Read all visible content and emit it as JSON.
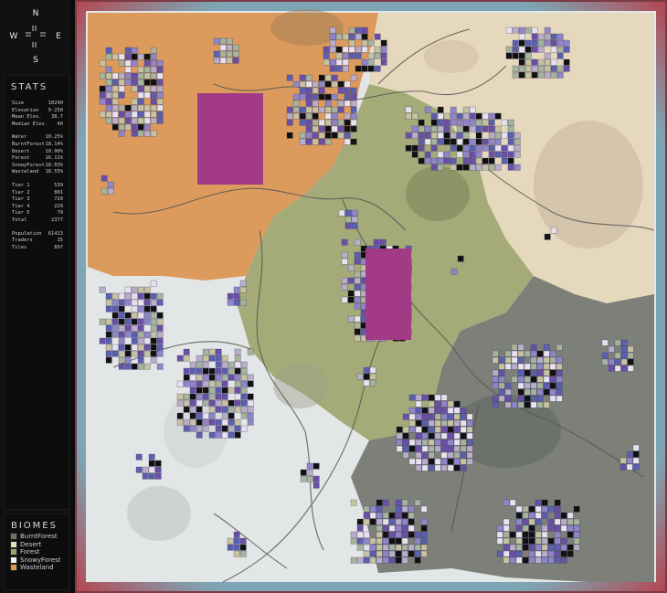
{
  "compass": {
    "north": "N",
    "south": "S",
    "east": "E",
    "west": "W"
  },
  "stats": {
    "title": "STATS",
    "groups": [
      [
        {
          "label": "Size",
          "value": "10240"
        },
        {
          "label": "Elevation",
          "value": "9-250"
        },
        {
          "label": "Mean Elev.",
          "value": "38.7"
        },
        {
          "label": "Median Elev.",
          "value": "40"
        }
      ],
      [
        {
          "label": "Water",
          "value": "10.25%"
        },
        {
          "label": "BurntForest",
          "value": "18.14%"
        },
        {
          "label": "Desert",
          "value": "10.90%"
        },
        {
          "label": "Forest",
          "value": "16.11%"
        },
        {
          "label": "SnowyForest",
          "value": "18.03%"
        },
        {
          "label": "Wasteland",
          "value": "18.55%"
        }
      ],
      [
        {
          "label": "Tier 1",
          "value": "539"
        },
        {
          "label": "Tier 2",
          "value": "801"
        },
        {
          "label": "Tier 3",
          "value": "729"
        },
        {
          "label": "Tier 4",
          "value": "229"
        },
        {
          "label": "Tier 5",
          "value": "79"
        },
        {
          "label": "Total",
          "value": "2377"
        }
      ],
      [
        {
          "label": "Population",
          "value": "61413"
        },
        {
          "label": "Traders",
          "value": "15"
        },
        {
          "label": "Tiles",
          "value": "897"
        }
      ]
    ]
  },
  "biomes": {
    "title": "BIOMES",
    "items": [
      {
        "label": "BurntForest",
        "color": "#6e726b"
      },
      {
        "label": "Desert",
        "color": "#e8dcc0"
      },
      {
        "label": "Forest",
        "color": "#9aa56e"
      },
      {
        "label": "SnowyForest",
        "color": "#eef0f0"
      },
      {
        "label": "Wasteland",
        "color": "#e59a4c"
      }
    ]
  },
  "colors": {
    "wasteland": "#dc9b5c",
    "desert": "#e6d8bc",
    "forest": "#a4ab78",
    "snowy": "#e3e6e6",
    "burnt": "#7c8079",
    "water": "#7ea5b3",
    "road": "#555555",
    "city_purple": "#6a4fa6",
    "city_magenta": "#a23a86"
  }
}
